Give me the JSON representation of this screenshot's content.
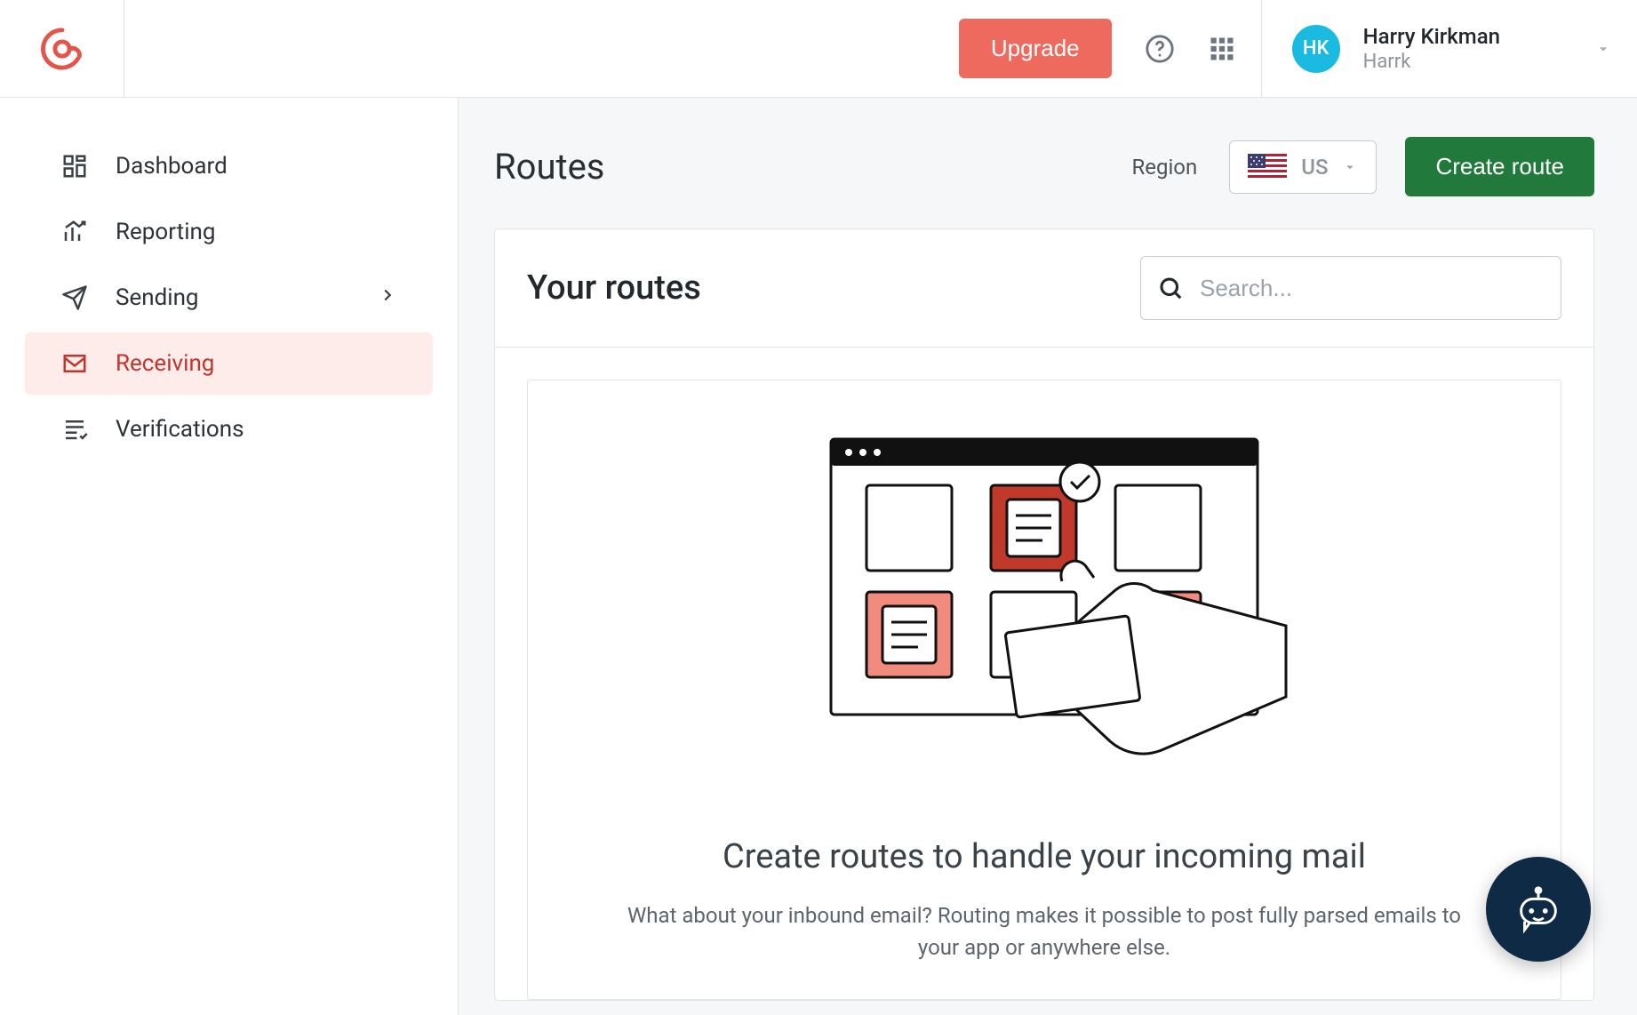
{
  "header": {
    "upgrade_label": "Upgrade",
    "user": {
      "initials": "HK",
      "name": "Harry Kirkman",
      "org": "Harrk"
    }
  },
  "sidebar": {
    "items": [
      {
        "label": "Dashboard",
        "id": "dashboard",
        "has_submenu": false
      },
      {
        "label": "Reporting",
        "id": "reporting",
        "has_submenu": false
      },
      {
        "label": "Sending",
        "id": "sending",
        "has_submenu": true
      },
      {
        "label": "Receiving",
        "id": "receiving",
        "has_submenu": false,
        "active": true
      },
      {
        "label": "Verifications",
        "id": "verifications",
        "has_submenu": false
      }
    ]
  },
  "page": {
    "title": "Routes",
    "region_label": "Region",
    "region_code": "US",
    "create_button_label": "Create route"
  },
  "card": {
    "title": "Your routes",
    "search_placeholder": "Search..."
  },
  "empty": {
    "title": "Create routes to handle your incoming mail",
    "description": "What about your inbound email? Routing makes it possible to post fully parsed emails to your app or anywhere else."
  }
}
